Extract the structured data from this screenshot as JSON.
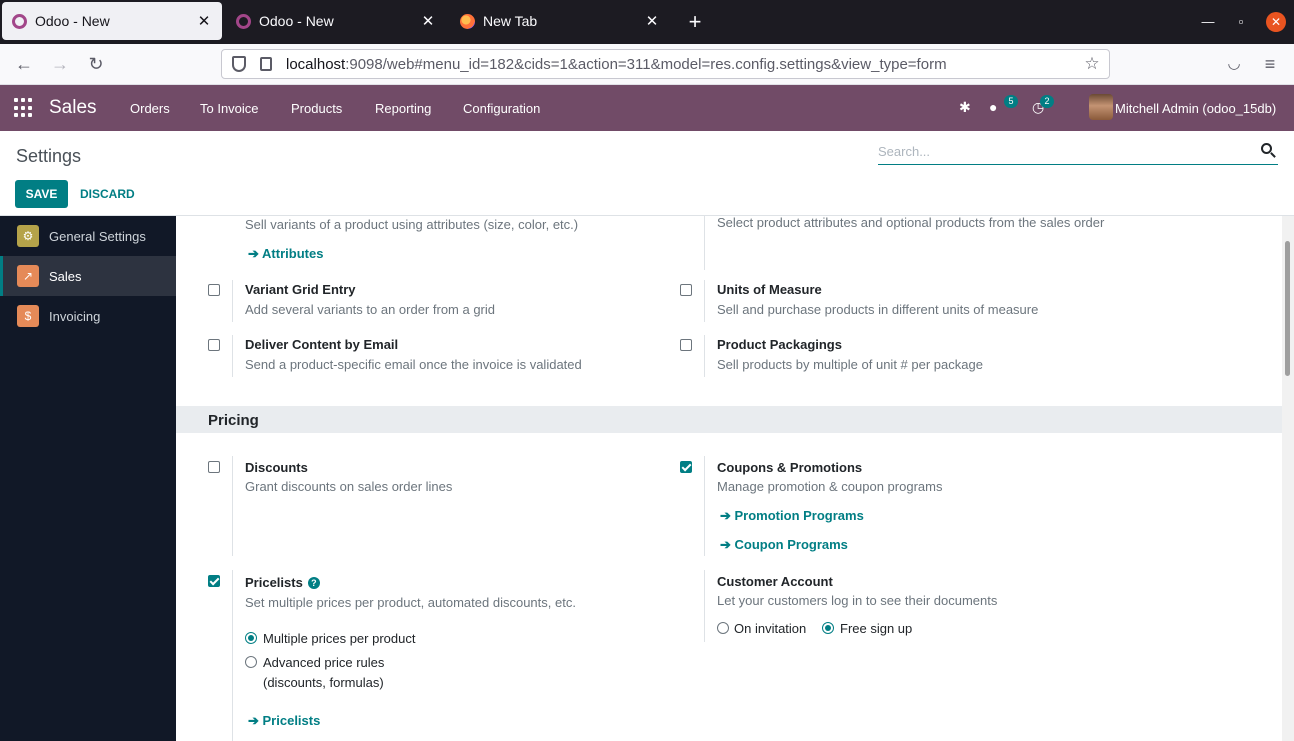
{
  "browser": {
    "tabs": [
      {
        "label": "Odoo - New",
        "active": true
      },
      {
        "label": "Odoo - New",
        "active": false
      },
      {
        "label": "New Tab",
        "active": false
      }
    ],
    "url_host": "localhost",
    "url_rest": ":9098/web#menu_id=182&cids=1&action=311&model=res.config.settings&view_type=form"
  },
  "topbar": {
    "app_name": "Sales",
    "menu": [
      "Orders",
      "To Invoice",
      "Products",
      "Reporting",
      "Configuration"
    ],
    "messages_count": "5",
    "activities_count": "2",
    "user": "Mitchell Admin (odoo_15db)"
  },
  "control_panel": {
    "title": "Settings",
    "search_placeholder": "Search...",
    "save_label": "SAVE",
    "discard_label": "DISCARD"
  },
  "sidebar": {
    "items": [
      {
        "label": "General Settings",
        "color": "#b5a34a"
      },
      {
        "label": "Sales",
        "color": "#e58a58"
      },
      {
        "label": "Invoicing",
        "color": "#e58a58"
      }
    ]
  },
  "settings": {
    "variants_desc": "Sell variants of a product using attributes (size, color, etc.)",
    "attributes_link": "Attributes",
    "configurator_desc": "Select product attributes and optional products from the sales order",
    "variant_grid": {
      "label": "Variant Grid Entry",
      "desc": "Add several variants to an order from a grid",
      "checked": false
    },
    "uom": {
      "label": "Units of Measure",
      "desc": "Sell and purchase products in different units of measure",
      "checked": false
    },
    "deliver_email": {
      "label": "Deliver Content by Email",
      "desc": "Send a product-specific email once the invoice is validated",
      "checked": false
    },
    "packagings": {
      "label": "Product Packagings",
      "desc": "Sell products by multiple of unit # per package",
      "checked": false
    },
    "pricing_section": "Pricing",
    "discounts": {
      "label": "Discounts",
      "desc": "Grant discounts on sales order lines",
      "checked": false
    },
    "coupons": {
      "label": "Coupons & Promotions",
      "desc": "Manage promotion & coupon programs",
      "checked": true,
      "link1": "Promotion Programs",
      "link2": "Coupon Programs"
    },
    "pricelists": {
      "label": "Pricelists",
      "desc": "Set multiple prices per product, automated discounts, etc.",
      "checked": true,
      "option1": "Multiple prices per product",
      "option2_line1": "Advanced price rules",
      "option2_line2": "(discounts, formulas)",
      "link": "Pricelists"
    },
    "customer_account": {
      "label": "Customer Account",
      "desc": "Let your customers log in to see their documents",
      "option1": "On invitation",
      "option2": "Free sign up"
    }
  },
  "colors": {
    "brand": "#714b67",
    "accent": "#017e84"
  }
}
